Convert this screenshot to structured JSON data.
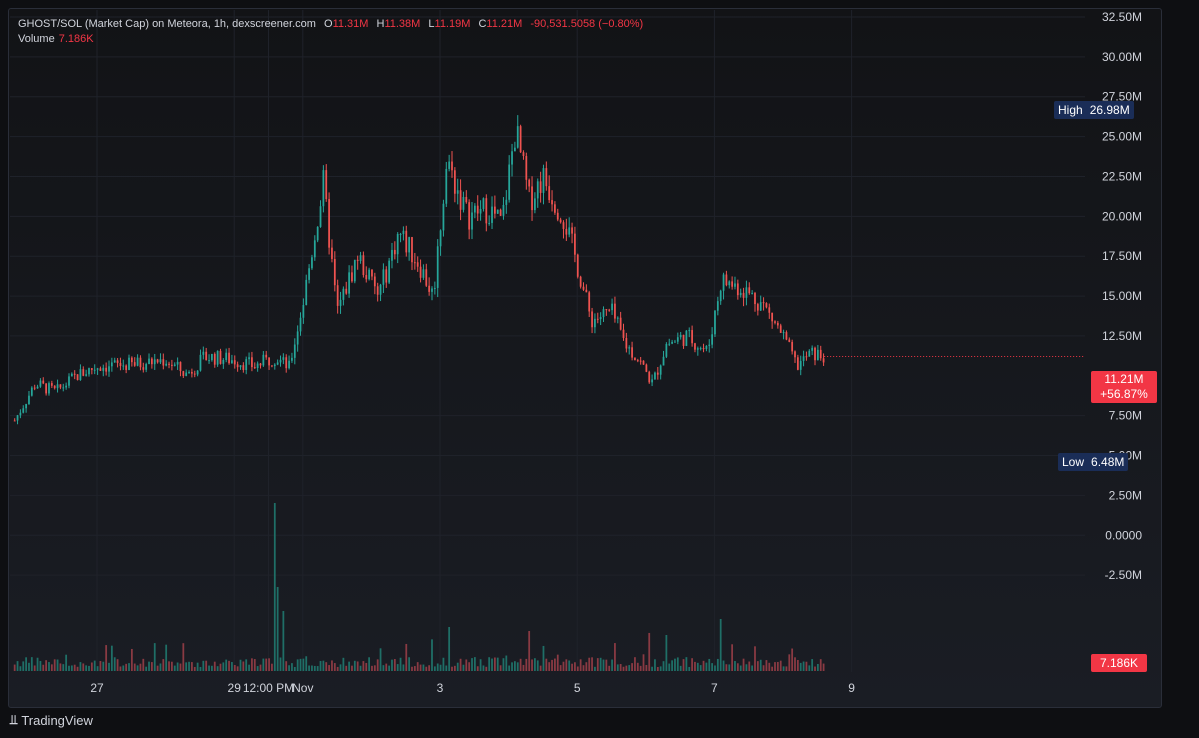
{
  "legend": {
    "symbol": "GHOST/SOL (Market Cap) on Meteora, 1h, dexscreener.com",
    "o_key": "O",
    "o_val": "11.31M",
    "h_key": "H",
    "h_val": "11.38M",
    "l_key": "L",
    "l_val": "11.19M",
    "c_key": "C",
    "c_val": "11.21M",
    "change": "-90,531.5058 (−0.80%)",
    "volume_label": "Volume",
    "volume_val": "7.186K"
  },
  "tags": {
    "high_label": "High",
    "high_val": "26.98M",
    "low_label": "Low",
    "low_val": "6.48M",
    "price_val": "11.21M",
    "price_pct": "+56.87%",
    "volume_val": "7.186K"
  },
  "branding": {
    "name": "TradingView",
    "logo": "⫫"
  },
  "colors": {
    "up": "#26a69a",
    "down": "#ef5350",
    "tag_red": "#f23645",
    "tag_blue": "#1a2d57",
    "grid": "#1f222a"
  },
  "chart_data": {
    "type": "candlestick",
    "title": "GHOST/SOL (Market Cap) on Meteora, 1h, dexscreener.com",
    "y_unit": "M",
    "ylim": [
      -5.0,
      32.5
    ],
    "y_ticks": [
      "32.50M",
      "30.00M",
      "27.50M",
      "25.00M",
      "22.50M",
      "20.00M",
      "17.50M",
      "15.00M",
      "12.50M",
      "7.50M",
      "5.00M",
      "2.50M",
      "0.0000",
      "-2.50M"
    ],
    "y_tick_values": [
      32.5,
      30,
      27.5,
      25,
      22.5,
      20,
      17.5,
      15,
      12.5,
      7.5,
      5,
      2.5,
      0,
      -2.5
    ],
    "x_ticks": [
      "27",
      "29",
      "12:00 PM",
      "Nov",
      "3",
      "5",
      "7",
      "9"
    ],
    "x_tick_days": [
      0,
      2,
      2.5,
      3,
      5,
      7,
      9,
      11
    ],
    "x_start_day": -1.2,
    "grid": true,
    "high": 26.98,
    "low": 6.48,
    "last": 11.21,
    "last_change_pct": 56.87,
    "anchors": [
      [
        -1.2,
        7.2
      ],
      [
        -0.9,
        9.5
      ],
      [
        -0.6,
        9.0
      ],
      [
        -0.3,
        10.0
      ],
      [
        0.0,
        10.6
      ],
      [
        0.5,
        10.7
      ],
      [
        1.0,
        11.0
      ],
      [
        1.3,
        10.1
      ],
      [
        1.6,
        11.2
      ],
      [
        2.0,
        11.0
      ],
      [
        2.3,
        10.6
      ],
      [
        2.6,
        11.2
      ],
      [
        2.8,
        10.5
      ],
      [
        3.0,
        14.5
      ],
      [
        3.3,
        22.0
      ],
      [
        3.5,
        14.0
      ],
      [
        3.8,
        17.5
      ],
      [
        4.1,
        15.0
      ],
      [
        4.4,
        19.0
      ],
      [
        4.7,
        17.0
      ],
      [
        4.9,
        15.0
      ],
      [
        5.1,
        23.5
      ],
      [
        5.4,
        20.0
      ],
      [
        5.7,
        20.5
      ],
      [
        5.9,
        19.5
      ],
      [
        6.1,
        25.5
      ],
      [
        6.3,
        21.0
      ],
      [
        6.5,
        22.5
      ],
      [
        6.8,
        20.0
      ],
      [
        7.0,
        17.0
      ],
      [
        7.2,
        13.5
      ],
      [
        7.5,
        14.0
      ],
      [
        7.7,
        12.0
      ],
      [
        7.9,
        11.0
      ],
      [
        8.1,
        9.5
      ],
      [
        8.3,
        12.0
      ],
      [
        8.6,
        12.5
      ],
      [
        8.9,
        11.5
      ],
      [
        9.1,
        16.0
      ],
      [
        9.4,
        15.5
      ],
      [
        9.7,
        14.5
      ],
      [
        10.0,
        12.5
      ],
      [
        10.2,
        10.6
      ],
      [
        10.4,
        11.4
      ],
      [
        10.6,
        11.21
      ]
    ],
    "volume_spikes": [
      [
        2.6,
        4.2
      ],
      [
        2.65,
        2.1
      ],
      [
        2.7,
        1.5
      ],
      [
        5.15,
        1.1
      ],
      [
        6.3,
        1.0
      ],
      [
        8.3,
        0.9
      ],
      [
        9.1,
        1.3
      ]
    ]
  }
}
